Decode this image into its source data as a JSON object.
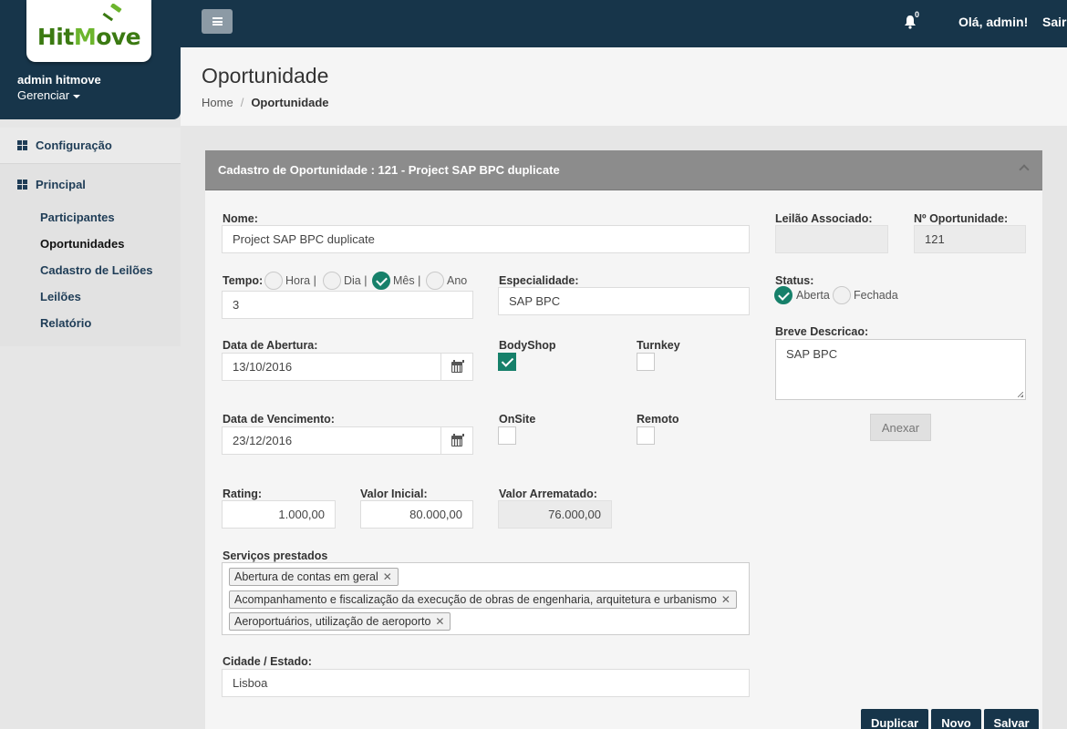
{
  "app": {
    "logo_text": "HitMove",
    "user_name": "admin hitmove",
    "manage_label": "Gerenciar",
    "notifications_count": "0",
    "greeting": "Olá, admin!",
    "logout": "Sair"
  },
  "sidebar": {
    "groups": [
      {
        "label": "Configuração"
      },
      {
        "label": "Principal"
      }
    ],
    "items": [
      {
        "label": "Participantes"
      },
      {
        "label": "Oportunidades"
      },
      {
        "label": "Cadastro de Leilões"
      },
      {
        "label": "Leilões"
      },
      {
        "label": "Relatório"
      }
    ]
  },
  "page": {
    "title": "Oportunidade",
    "breadcrumb": [
      "Home",
      "Oportunidade"
    ]
  },
  "panel": {
    "title": "Cadastro de Oportunidade : 121 - Project SAP BPC duplicate"
  },
  "form": {
    "nome": {
      "label": "Nome:",
      "value": "Project SAP BPC duplicate"
    },
    "tempo": {
      "label": "Tempo:",
      "options": [
        "Hora |",
        "Dia |",
        "Mês |",
        "Ano"
      ],
      "selected": "Mês",
      "value": "3"
    },
    "especialidade": {
      "label": "Especialidade:",
      "value": "SAP BPC"
    },
    "data_abertura": {
      "label": "Data de Abertura:",
      "value": "13/10/2016"
    },
    "data_vencimento": {
      "label": "Data de Vencimento:",
      "value": "23/12/2016"
    },
    "bodyshop": {
      "label": "BodyShop",
      "checked": true
    },
    "turnkey": {
      "label": "Turnkey",
      "checked": false
    },
    "onsite": {
      "label": "OnSite",
      "checked": false
    },
    "remoto": {
      "label": "Remoto",
      "checked": false
    },
    "rating": {
      "label": "Rating:",
      "value": "1.000,00"
    },
    "valor_inicial": {
      "label": "Valor Inicial:",
      "value": "80.000,00"
    },
    "valor_arrematado": {
      "label": "Valor Arrematado:",
      "value": "76.000,00"
    },
    "servicos": {
      "label": "Serviços prestados",
      "tags": [
        "Abertura de contas em geral",
        "Acompanhamento e fiscalização da execução de obras de engenharia, arquitetura e urbanismo",
        "Aeroportuários, utilização de aeroporto"
      ],
      "remove_glyph": "✕"
    },
    "cidade": {
      "label": "Cidade / Estado:",
      "value": "Lisboa"
    },
    "leilao_associado": {
      "label": "Leilão Associado:",
      "value": ""
    },
    "n_oportunidade": {
      "label": "Nº Oportunidade:",
      "value": "121"
    },
    "status": {
      "label": "Status:",
      "options": [
        "Aberta",
        "Fechada"
      ],
      "selected": "Aberta"
    },
    "breve_descricao": {
      "label": "Breve Descricao:",
      "value": "SAP BPC"
    }
  },
  "buttons": {
    "anexar": "Anexar",
    "duplicar": "Duplicar",
    "novo": "Novo",
    "salvar": "Salvar"
  },
  "colors": {
    "navy": "#17354a",
    "accent_green": "#16806a",
    "panel_header": "#8c8c8c"
  }
}
